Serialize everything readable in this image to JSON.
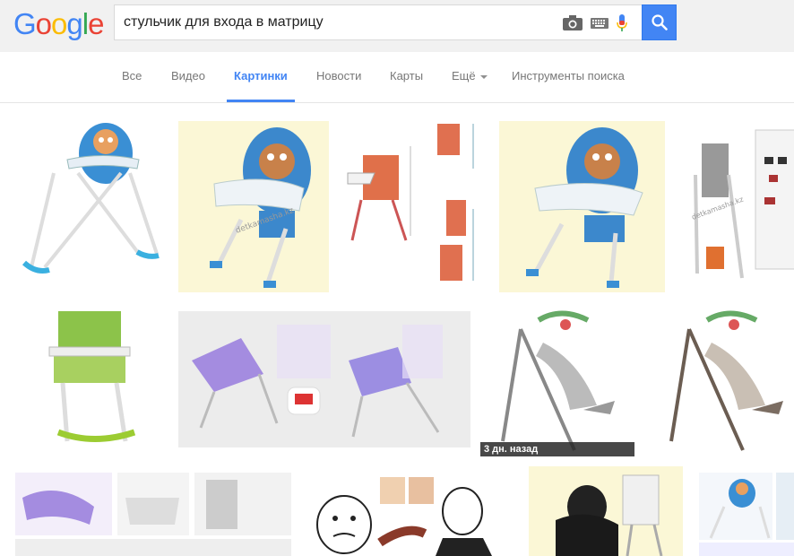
{
  "search": {
    "query": "стульчик для входа в матрицу"
  },
  "logo": [
    "G",
    "o",
    "o",
    "g",
    "l",
    "e"
  ],
  "logo_colors": [
    "#4285f4",
    "#ea4335",
    "#fbbc05",
    "#4285f4",
    "#34a853",
    "#ea4335"
  ],
  "nav": {
    "all": "Все",
    "video": "Видео",
    "images": "Картинки",
    "news": "Новости",
    "maps": "Карты",
    "more": "Ещё",
    "tools": "Инструменты поиска"
  },
  "results": {
    "badge": "3 дн. назад",
    "watermark": "detkamasha.kz"
  },
  "colors": {
    "accent": "#4285f4",
    "topbar": "#f1f1f1"
  }
}
